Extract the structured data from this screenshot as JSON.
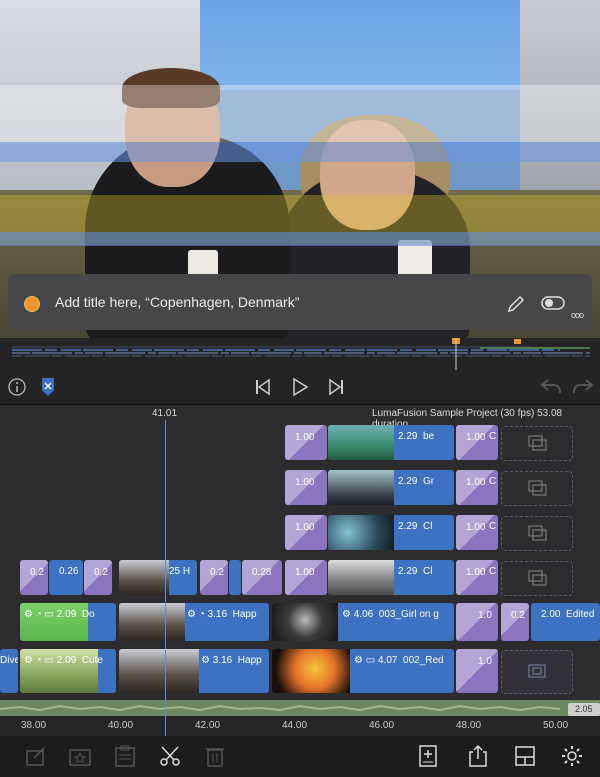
{
  "title_bar": {
    "text": "Add title here, “Copenhagen, Denmark”",
    "more_label": "ooo"
  },
  "timeline": {
    "playhead_time": "41.01",
    "project_info": "LumaFusion Sample Project (30 fps)  53.08 duration",
    "tracks": [
      {
        "transition": "1.00",
        "clip_duration": "2.29",
        "clip_name": "be",
        "transition2": "1.00",
        "end_label": "C"
      },
      {
        "transition": "1.00",
        "clip_duration": "2.29",
        "clip_name": "Gr",
        "transition2": "1.00",
        "end_label": "C"
      },
      {
        "transition": "1.00",
        "clip_duration": "2.29",
        "clip_name": "Cl",
        "transition2": "1.00",
        "end_label": "C"
      },
      {
        "t1": "0.2",
        "t2": "0.26",
        "t3": "0.2",
        "clip_a": "25 H",
        "t4": "0.2",
        "t5": "0.28",
        "transition": "1.00",
        "clip_duration": "2.29",
        "clip_name": "Cl",
        "transition2": "1.00",
        "end_label": "C"
      }
    ],
    "main_track_1": {
      "clip1_duration": "2.09",
      "clip1_name": "Do",
      "clip2_duration": "3.16",
      "clip2_name": "Happ",
      "clip3_duration": "4.06",
      "clip3_name": "003_Girl on g",
      "trans": "1.0",
      "trans2": "0.2",
      "clip4_duration": "2.00",
      "clip4_name": "Edited"
    },
    "main_track_2": {
      "clip0_name": "Dive",
      "clip1_duration": "2.09",
      "clip1_name": "Cute",
      "clip2_duration": "3.16",
      "clip2_name": "Happ",
      "clip3_duration": "4.07",
      "clip3_name": "002_Red",
      "trans": "1.0"
    },
    "audio_end_label": "2.05",
    "ruler": [
      "38.00",
      "40.00",
      "42.00",
      "44.00",
      "46.00",
      "48.00",
      "50.00"
    ]
  },
  "colors": {
    "accent": "#f2942c",
    "clip_blue": "#3d72c2",
    "transition_purple": "#8a75be",
    "background": "#1c1c1e"
  },
  "icons": [
    "info-icon",
    "marker-icon",
    "skip-back-icon",
    "play-icon",
    "skip-forward-icon",
    "undo-icon",
    "redo-icon",
    "pencil-icon",
    "toggle-icon",
    "edit-clip-icon",
    "favorite-icon",
    "clipboard-icon",
    "scissors-icon",
    "trash-icon",
    "add-track-icon",
    "share-icon",
    "layout-icon",
    "settings-icon"
  ]
}
